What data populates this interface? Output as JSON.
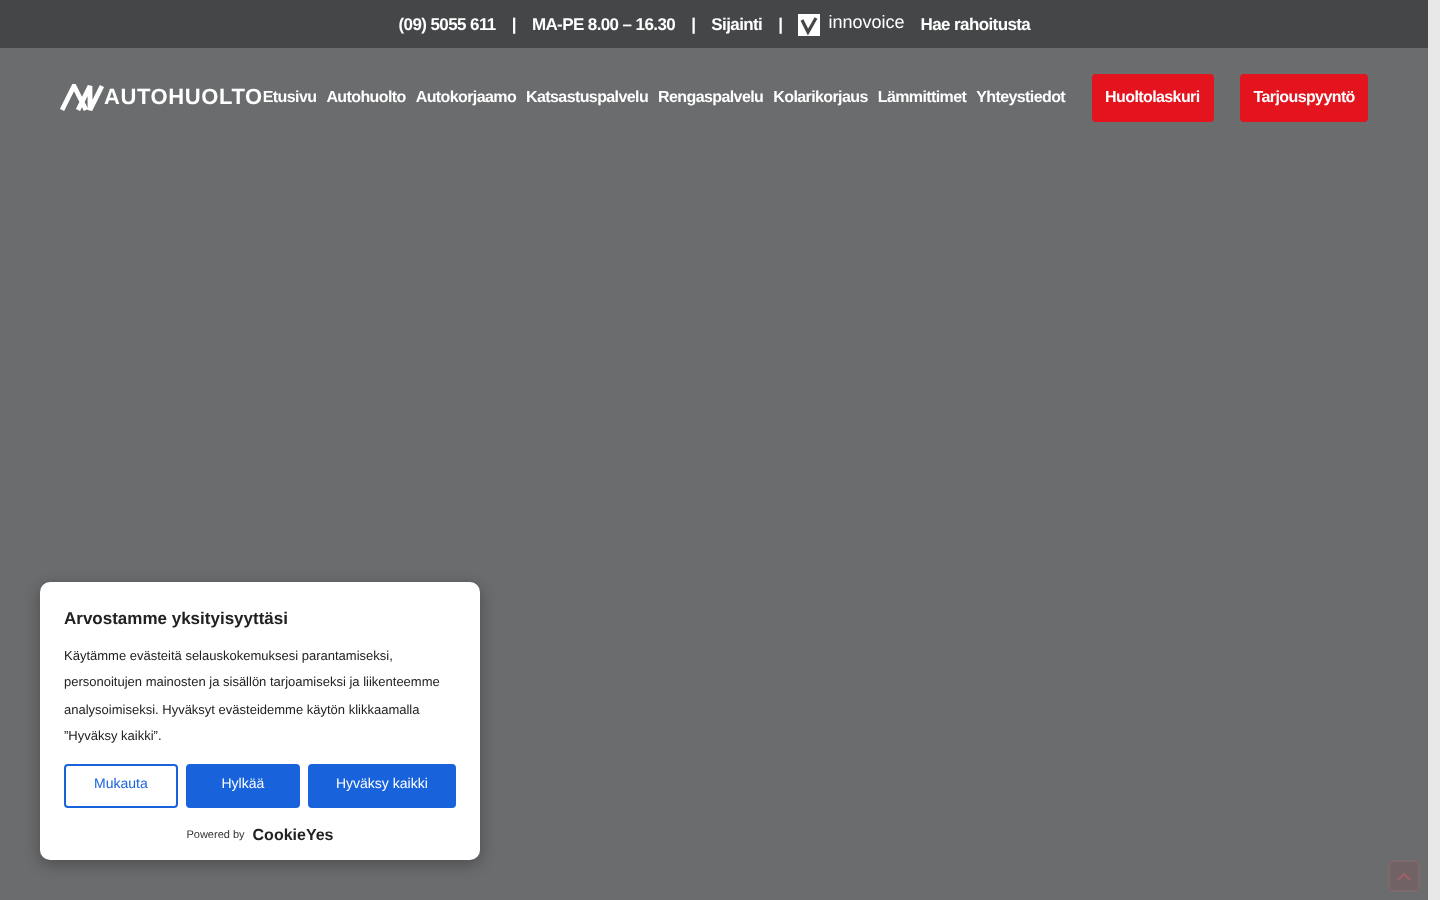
{
  "top_bar": {
    "items": [
      {
        "kind": "text",
        "text": "(09) 5055 611"
      },
      {
        "kind": "sep",
        "text": "|"
      },
      {
        "kind": "text",
        "text": "MA-PE 8.00 – 16.30"
      },
      {
        "kind": "sep",
        "text": "|"
      },
      {
        "kind": "link",
        "text": "Sijainti"
      },
      {
        "kind": "sep",
        "text": "|"
      },
      {
        "kind": "logo",
        "text": "innovoice"
      },
      {
        "kind": "link",
        "text": "Hae rahoitusta"
      }
    ]
  },
  "header": {
    "logo": "AUTOHUOLTO",
    "nav": [
      "Etusivu",
      "Autohuolto",
      "Autokorjaamo",
      "Katsastuspalvelu",
      "Rengaspalvelu",
      "Kolarikorjaus",
      "Lämmittimet",
      "Yhteystiedot"
    ],
    "buttons": [
      "Huoltolaskuri",
      "Tarjouspyyntö"
    ]
  },
  "cookie_banner": {
    "title": "Arvostamme yksityisyyttäsi",
    "text": "Käytämme evästeitä selauskokemuksesi parantamiseksi, personoitujen mainosten ja sisällön tarjoamiseksi ja liikenteemme analysoimiseksi. Hyväksyt evästeidemme käytön klikkaamalla ”Hyväksy kaikki”.",
    "buttons": [
      {
        "kind": "outline",
        "label": "Mukauta"
      },
      {
        "kind": "solid",
        "label": "Hylkää"
      },
      {
        "kind": "solid",
        "label": "Hyväksy kaikki"
      }
    ],
    "powered_by": "Powered by",
    "brand": "CookieYes"
  }
}
